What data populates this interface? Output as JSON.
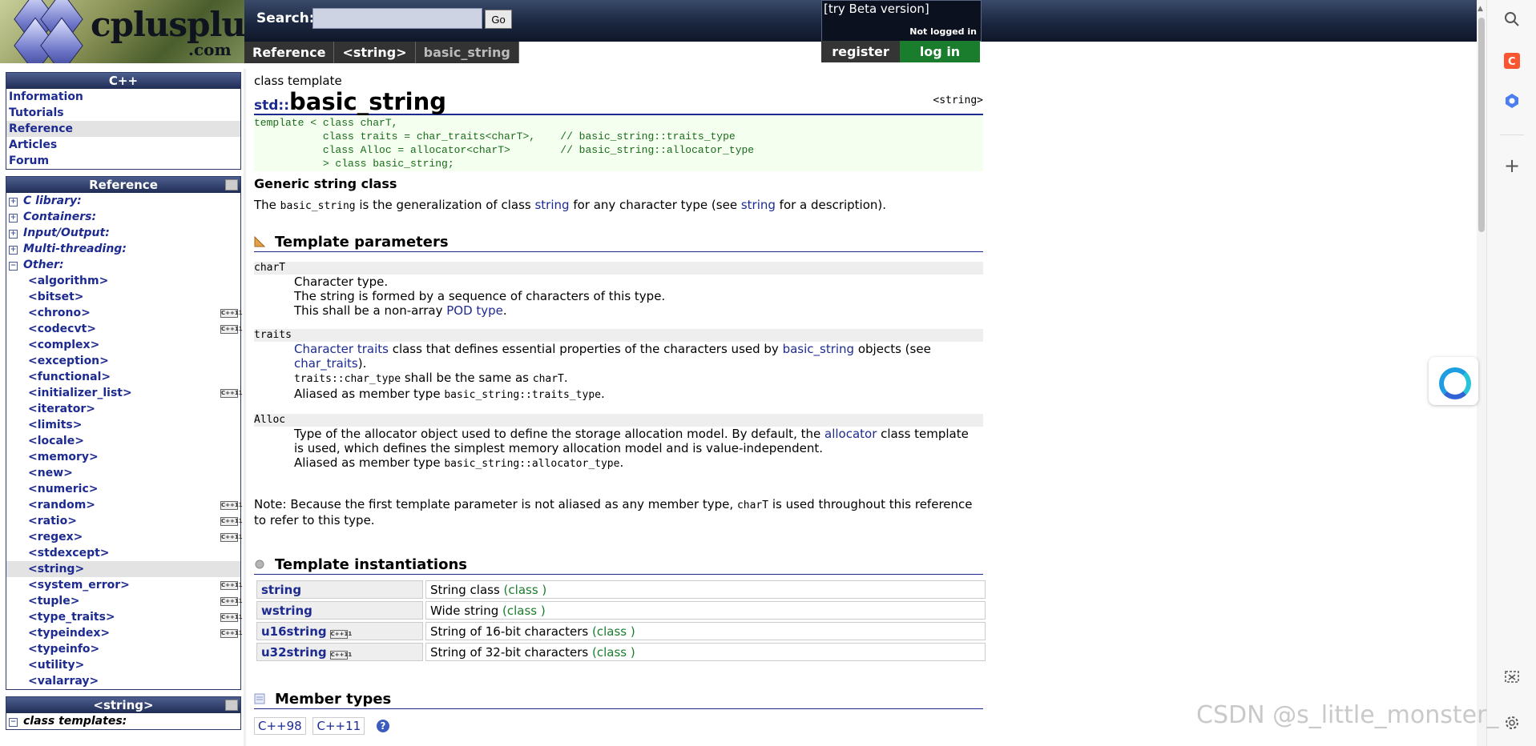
{
  "header": {
    "logo_name": "cplusplus",
    "logo_suffix": ".com",
    "search_label": "Search:",
    "search_value": "",
    "go_label": "Go",
    "beta_label": "[try Beta version]",
    "login_status": "Not logged in",
    "register_label": "register",
    "login_label": "log in"
  },
  "breadcrumb": [
    "Reference",
    "<string>",
    "basic_string"
  ],
  "sidebar": {
    "cpp_box": {
      "title": "C++",
      "items": [
        "Information",
        "Tutorials",
        "Reference",
        "Articles",
        "Forum"
      ]
    },
    "reference_box": {
      "title": "Reference",
      "categories": [
        "C library:",
        "Containers:",
        "Input/Output:",
        "Multi-threading:",
        "Other:"
      ],
      "headers": [
        {
          "label": "<algorithm>",
          "cpp11": false
        },
        {
          "label": "<bitset>",
          "cpp11": false
        },
        {
          "label": "<chrono>",
          "cpp11": true
        },
        {
          "label": "<codecvt>",
          "cpp11": true
        },
        {
          "label": "<complex>",
          "cpp11": false
        },
        {
          "label": "<exception>",
          "cpp11": false
        },
        {
          "label": "<functional>",
          "cpp11": false
        },
        {
          "label": "<initializer_list>",
          "cpp11": true
        },
        {
          "label": "<iterator>",
          "cpp11": false
        },
        {
          "label": "<limits>",
          "cpp11": false
        },
        {
          "label": "<locale>",
          "cpp11": false
        },
        {
          "label": "<memory>",
          "cpp11": false
        },
        {
          "label": "<new>",
          "cpp11": false
        },
        {
          "label": "<numeric>",
          "cpp11": false
        },
        {
          "label": "<random>",
          "cpp11": true
        },
        {
          "label": "<ratio>",
          "cpp11": true
        },
        {
          "label": "<regex>",
          "cpp11": true
        },
        {
          "label": "<stdexcept>",
          "cpp11": false
        },
        {
          "label": "<string>",
          "cpp11": false
        },
        {
          "label": "<system_error>",
          "cpp11": true
        },
        {
          "label": "<tuple>",
          "cpp11": true
        },
        {
          "label": "<type_traits>",
          "cpp11": true
        },
        {
          "label": "<typeindex>",
          "cpp11": true
        },
        {
          "label": "<typeinfo>",
          "cpp11": false
        },
        {
          "label": "<utility>",
          "cpp11": false
        },
        {
          "label": "<valarray>",
          "cpp11": false
        }
      ],
      "selected": "<string>"
    },
    "string_box": {
      "title": "<string>",
      "first_category": "class templates:"
    },
    "badge_text": "C++11"
  },
  "main": {
    "kind": "class template",
    "namespace": "std::",
    "name": "basic_string",
    "header_file": "<string>",
    "prototype": [
      "template < class charT,",
      "           class traits = char_traits<charT>,    // basic_string::traits_type",
      "           class Alloc = allocator<charT>        // basic_string::allocator_type",
      "           > class basic_string;"
    ],
    "subtitle": "Generic string class",
    "intro": {
      "t1": "The ",
      "code1": "basic_string",
      "t2": " is the generalization of class ",
      "link1": "string",
      "t3": " for any character type (see ",
      "link2": "string",
      "t4": " for a description)."
    },
    "template_params_title": "Template parameters",
    "params": {
      "charT": {
        "name": "charT",
        "l1": "Character type.",
        "l2": "The string is formed by a sequence of characters of this type.",
        "l3a": "This shall be a non-array ",
        "l3link": "POD type",
        "l3b": "."
      },
      "traits": {
        "name": "traits",
        "link1": "Character traits",
        "t1": " class that defines essential properties of the characters used by ",
        "link2": "basic_string",
        "t2": " objects (see",
        "link3": "char_traits",
        "t3": ").",
        "code1": "traits::char_type",
        "t4": " shall be the same as ",
        "code2": "charT",
        "t5": ".",
        "t6": "Aliased as member type ",
        "code3": "basic_string::traits_type",
        "t7": "."
      },
      "alloc": {
        "name": "Alloc",
        "t1": "Type of the allocator object used to define the storage allocation model. By default, the ",
        "link1": "allocator",
        "t2": " class template",
        "t3": "is used, which defines the simplest memory allocation model and is value-independent.",
        "t4": "Aliased as member type ",
        "code1": "basic_string::allocator_type",
        "t5": "."
      }
    },
    "note": {
      "t1": "Note: Because the first template parameter is not aliased as any member type, ",
      "code1": "charT",
      "t2": " is used throughout this reference",
      "t3": "to refer to this type."
    },
    "instantiations_title": "Template instantiations",
    "instantiations": [
      {
        "name": "string",
        "cpp11": false,
        "desc": "String class ",
        "kind": "(class )"
      },
      {
        "name": "wstring",
        "cpp11": false,
        "desc": "Wide string ",
        "kind": "(class )"
      },
      {
        "name": "u16string",
        "cpp11": true,
        "desc": "String of 16-bit characters ",
        "kind": "(class )"
      },
      {
        "name": "u32string",
        "cpp11": true,
        "desc": "String of 32-bit characters ",
        "kind": "(class )"
      }
    ],
    "member_types_title": "Member types",
    "version_tabs": [
      "C++98",
      "C++11"
    ],
    "help": "?"
  },
  "watermark": "CSDN @s_little_monster_"
}
